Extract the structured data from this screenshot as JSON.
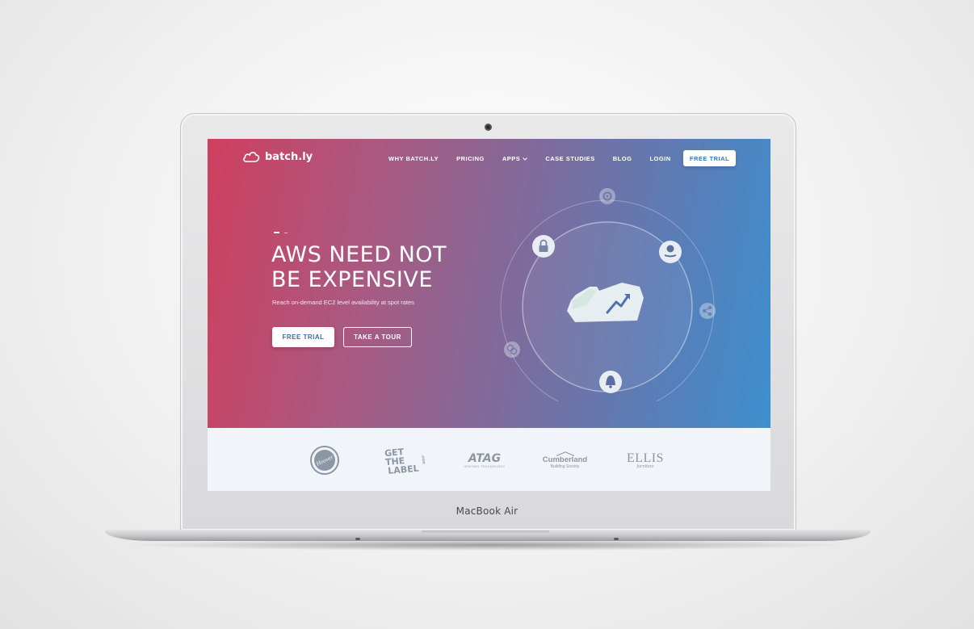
{
  "device": {
    "label": "MacBook Air"
  },
  "site": {
    "logo_text": "batch.ly",
    "nav": [
      {
        "label": "WHY BATCH.LY"
      },
      {
        "label": "PRICING"
      },
      {
        "label": "APPS"
      },
      {
        "label": "CASE STUDIES"
      },
      {
        "label": "BLOG"
      },
      {
        "label": "LOGIN"
      }
    ],
    "nav_cta": "FREE TRIAL",
    "hero": {
      "headline_line1": "AWS NEED NOT",
      "headline_line2": "BE EXPENSIVE",
      "subline": "Reach on-demand EC2 level availability at spot rates",
      "primary_button": "FREE TRIAL",
      "secondary_button": "TAKE A TOUR"
    },
    "illustration_icons": [
      "gear-icon",
      "lock-icon",
      "dollar-hand-icon",
      "share-icon",
      "bell-icon",
      "coins-icon",
      "cloud-trend-icon"
    ],
    "clients": [
      {
        "name": "Hoover"
      },
      {
        "name_line1": "GET THE",
        "name_line2": "LABEL",
        "name_side": ".com"
      },
      {
        "name": "ATAG",
        "tagline": "HEATING TECHNOLOGY"
      },
      {
        "name": "Cumberland",
        "tagline": "Building Society"
      },
      {
        "name": "ELLIS",
        "tagline": "furniture"
      }
    ],
    "colors": {
      "gradient_start": "#cf3f5f",
      "gradient_end": "#3d8fcf",
      "button_text": "#3a6ea8",
      "client_logo_gray": "#8d96a3"
    }
  }
}
